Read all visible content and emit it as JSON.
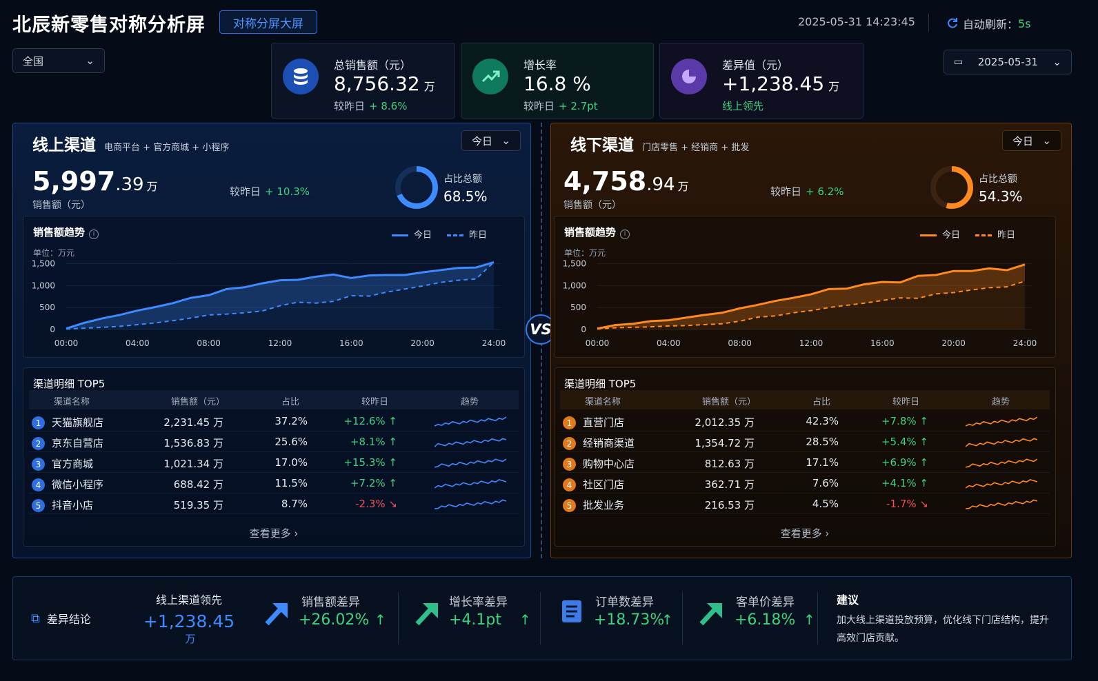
{
  "header": {
    "title": "北辰新零售对称分析屏",
    "badge": "对称分屏大屏",
    "datetime": "2025-05-31 14:23:45",
    "refresh_label": "自动刷新：",
    "refresh_value": "5s",
    "region": "全国",
    "date": "2025-05-31"
  },
  "kpis": [
    {
      "label": "总销售额（元）",
      "value": "8,756.32",
      "unit": "万",
      "sub_label": "较昨日",
      "sub_value": "+ 8.6%",
      "icon": "database-icon",
      "color": "#2f7df0"
    },
    {
      "label": "增长率",
      "value": "16.8 %",
      "unit": "",
      "sub_label": "较昨日",
      "sub_value": "+ 2.7pt",
      "icon": "trend-up-icon",
      "color": "#1fb98a"
    },
    {
      "label": "差异值（元）",
      "value": "+1,238.45",
      "unit": "万",
      "sub_label": "",
      "sub_value": "线上领先",
      "icon": "pie-icon",
      "color": "#9a6bf2"
    }
  ],
  "online": {
    "title": "线上渠道",
    "subtitle": "电商平台 + 官方商城 + 小程序",
    "period": "今日",
    "amount_int": "5,997",
    "amount_dec": ".39",
    "unit": "万",
    "amount_label": "销售额（元）",
    "cmp_label": "较昨日",
    "cmp_value": "+ 10.3%",
    "share_label": "占比总额",
    "share_value": "68.5%",
    "share_fraction": 0.685,
    "trend_title": "销售额趋势",
    "legend_today": "今日",
    "legend_yesterday": "昨日",
    "unit_note": "单位：万元",
    "table_title": "渠道明细 TOP5",
    "more": "查看更多 ›",
    "columns": [
      "渠道名称",
      "销售额（元）",
      "占比",
      "较昨日",
      "趋势"
    ],
    "rows": [
      {
        "rank": "1",
        "name": "天猫旗舰店",
        "amount": "2,231.45 万",
        "share": "37.2%",
        "change": "+12.6%",
        "dir": "up"
      },
      {
        "rank": "2",
        "name": "京东自营店",
        "amount": "1,536.83 万",
        "share": "25.6%",
        "change": "+8.1%",
        "dir": "up"
      },
      {
        "rank": "3",
        "name": "官方商城",
        "amount": "1,021.34 万",
        "share": "17.0%",
        "change": "+15.3%",
        "dir": "up"
      },
      {
        "rank": "4",
        "name": "微信小程序",
        "amount": "688.42 万",
        "share": "11.5%",
        "change": "+7.2%",
        "dir": "up"
      },
      {
        "rank": "5",
        "name": "抖音小店",
        "amount": "519.35 万",
        "share": "8.7%",
        "change": "-2.3%",
        "dir": "down"
      }
    ]
  },
  "offline": {
    "title": "线下渠道",
    "subtitle": "门店零售 + 经销商 + 批发",
    "period": "今日",
    "amount_int": "4,758",
    "amount_dec": ".94",
    "unit": "万",
    "amount_label": "销售额（元）",
    "cmp_label": "较昨日",
    "cmp_value": "+ 6.2%",
    "share_label": "占比总额",
    "share_value": "54.3%",
    "share_fraction": 0.543,
    "trend_title": "销售额趋势",
    "legend_today": "今日",
    "legend_yesterday": "昨日",
    "unit_note": "单位：万元",
    "table_title": "渠道明细 TOP5",
    "more": "查看更多 ›",
    "columns": [
      "渠道名称",
      "销售额（元）",
      "占比",
      "较昨日",
      "趋势"
    ],
    "rows": [
      {
        "rank": "1",
        "name": "直营门店",
        "amount": "2,012.35 万",
        "share": "42.3%",
        "change": "+7.8%",
        "dir": "up"
      },
      {
        "rank": "2",
        "name": "经销商渠道",
        "amount": "1,354.72 万",
        "share": "28.5%",
        "change": "+5.4%",
        "dir": "up"
      },
      {
        "rank": "3",
        "name": "购物中心店",
        "amount": "812.63 万",
        "share": "17.1%",
        "change": "+6.9%",
        "dir": "up"
      },
      {
        "rank": "4",
        "name": "社区门店",
        "amount": "362.71 万",
        "share": "7.6%",
        "change": "+4.1%",
        "dir": "up"
      },
      {
        "rank": "5",
        "name": "批发业务",
        "amount": "216.53 万",
        "share": "4.5%",
        "change": "-1.7%",
        "dir": "down"
      }
    ]
  },
  "vs": "VS",
  "footer": {
    "conclusion_label": "差异结论",
    "lead_label": "线上渠道领先",
    "lead_value": "+1,238.45",
    "lead_unit": "万",
    "metrics": [
      {
        "label": "销售额差异",
        "value": "+26.02%"
      },
      {
        "label": "增长率差异",
        "value": "+4.1pt"
      },
      {
        "label": "订单数差异",
        "value": "+18.73%"
      },
      {
        "label": "客单价差异",
        "value": "+6.18%"
      }
    ],
    "advice_title": "建议",
    "advice_text": "加大线上渠道投放预算，优化线下门店结构，提升高效门店贡献。"
  },
  "chart_data": [
    {
      "type": "area",
      "title": "销售额趋势",
      "ylabel": "单位：万元",
      "x": [
        "00:00",
        "01:00",
        "02:00",
        "03:00",
        "04:00",
        "05:00",
        "06:00",
        "07:00",
        "08:00",
        "09:00",
        "10:00",
        "11:00",
        "12:00",
        "13:00",
        "14:00",
        "15:00",
        "16:00",
        "17:00",
        "18:00",
        "19:00",
        "20:00",
        "21:00",
        "22:00",
        "23:00",
        "24:00"
      ],
      "xticks": [
        "00:00",
        "04:00",
        "08:00",
        "12:00",
        "16:00",
        "20:00",
        "24:00"
      ],
      "yticks": [
        0,
        500,
        1000,
        1500
      ],
      "ylim": [
        0,
        1600
      ],
      "series": [
        {
          "name": "今日",
          "values": [
            20,
            150,
            250,
            330,
            430,
            510,
            600,
            720,
            780,
            920,
            960,
            1050,
            1120,
            1130,
            1200,
            1250,
            1170,
            1230,
            1240,
            1240,
            1300,
            1350,
            1400,
            1410,
            1530
          ]
        },
        {
          "name": "昨日",
          "values": [
            10,
            30,
            50,
            70,
            110,
            150,
            200,
            260,
            330,
            350,
            380,
            420,
            540,
            620,
            600,
            640,
            770,
            760,
            850,
            920,
            990,
            1070,
            1120,
            1150,
            1530
          ]
        }
      ]
    },
    {
      "type": "area",
      "title": "销售额趋势",
      "ylabel": "单位：万元",
      "x": [
        "00:00",
        "01:00",
        "02:00",
        "03:00",
        "04:00",
        "05:00",
        "06:00",
        "07:00",
        "08:00",
        "09:00",
        "10:00",
        "11:00",
        "12:00",
        "13:00",
        "14:00",
        "15:00",
        "16:00",
        "17:00",
        "18:00",
        "19:00",
        "20:00",
        "21:00",
        "22:00",
        "23:00",
        "24:00"
      ],
      "xticks": [
        "00:00",
        "04:00",
        "08:00",
        "12:00",
        "16:00",
        "20:00",
        "24:00"
      ],
      "yticks": [
        0,
        500,
        1000,
        1500
      ],
      "ylim": [
        0,
        1600
      ],
      "series": [
        {
          "name": "今日",
          "values": [
            20,
            100,
            130,
            190,
            210,
            270,
            330,
            380,
            480,
            560,
            650,
            720,
            800,
            920,
            930,
            1030,
            1080,
            1070,
            1220,
            1240,
            1330,
            1330,
            1390,
            1350,
            1480
          ]
        },
        {
          "name": "昨日",
          "values": [
            10,
            40,
            50,
            60,
            80,
            90,
            110,
            130,
            190,
            280,
            310,
            380,
            430,
            500,
            550,
            600,
            660,
            720,
            710,
            810,
            840,
            900,
            950,
            970,
            1100
          ]
        }
      ]
    }
  ]
}
